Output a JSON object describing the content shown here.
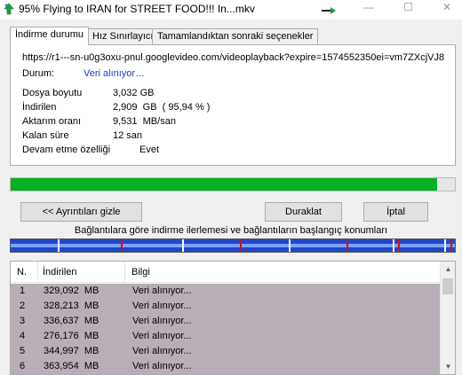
{
  "window": {
    "title": "95% Flying to IRAN for STREET FOOD!!! In...mkv",
    "minimize_glyph": "—",
    "close_glyph": "✕",
    "icon": "idm-app-icon",
    "accent_color": "#1ea03c"
  },
  "tabs": [
    {
      "label": "İndirme durumu",
      "active": true
    },
    {
      "label": "Hız Sınırlayıcı",
      "active": false
    },
    {
      "label": "Tamamlandıktan sonraki seçenekler",
      "active": false
    }
  ],
  "status": {
    "url": "https://r1---sn-u0g3oxu-pnul.googlevideo.com/videoplayback?expire=1574552350ei=vm7ZXcjVJ8",
    "state_label": "Durum:",
    "state_value": "Veri alınıyor…",
    "file_size_label": "Dosya boyutu",
    "file_size_value": "3,032  GB",
    "downloaded_label": "İndirilen",
    "downloaded_value": "2,909  GB  ( 95,94 % )",
    "rate_label": "Aktarım oranı",
    "rate_value": "9,531  MB/san",
    "remaining_label": "Kalan süre",
    "remaining_value": "12 san",
    "resume_label": "Devam etme özelliği",
    "resume_value": "Evet"
  },
  "progress": {
    "percent": 95.94,
    "color": "#06b025"
  },
  "buttons": {
    "details": "<< Ayrıntıları gizle",
    "pause": "Duraklat",
    "cancel": "İptal"
  },
  "connections_caption": "Bağlantılara göre indirme ilerlemesi ve bağlantıların başlangıç konumları",
  "connections_map": {
    "colors": {
      "background": "#2248c8",
      "progress": "#7fa0ff",
      "start_marker": "#ffffff",
      "active_marker": "#d01010"
    },
    "markers": [
      {
        "pos": 0.105,
        "type": "start_marker"
      },
      {
        "pos": 0.248,
        "type": "active_marker"
      },
      {
        "pos": 0.385,
        "type": "start_marker"
      },
      {
        "pos": 0.515,
        "type": "active_marker"
      },
      {
        "pos": 0.625,
        "type": "start_marker"
      },
      {
        "pos": 0.755,
        "type": "active_marker"
      },
      {
        "pos": 0.86,
        "type": "start_marker"
      },
      {
        "pos": 0.872,
        "type": "active_marker"
      },
      {
        "pos": 0.975,
        "type": "start_marker"
      },
      {
        "pos": 0.99,
        "type": "active_marker"
      }
    ]
  },
  "connections_table": {
    "headers": [
      "N.",
      "İndirilen",
      "Bilgi"
    ],
    "row_color": "#b7aeb8",
    "rows": [
      {
        "n": "1",
        "downloaded": "329,092  MB",
        "info": "Veri alınıyor..."
      },
      {
        "n": "2",
        "downloaded": "328,213  MB",
        "info": "Veri alınıyor..."
      },
      {
        "n": "3",
        "downloaded": "336,637  MB",
        "info": "Veri alınıyor..."
      },
      {
        "n": "4",
        "downloaded": "276,176  MB",
        "info": "Veri alınıyor..."
      },
      {
        "n": "5",
        "downloaded": "344,997  MB",
        "info": "Veri alınıyor..."
      },
      {
        "n": "6",
        "downloaded": "363,954  MB",
        "info": "Veri alınıyor..."
      }
    ],
    "scroll_up_icon": "▲",
    "scroll_down_icon": "▼"
  }
}
